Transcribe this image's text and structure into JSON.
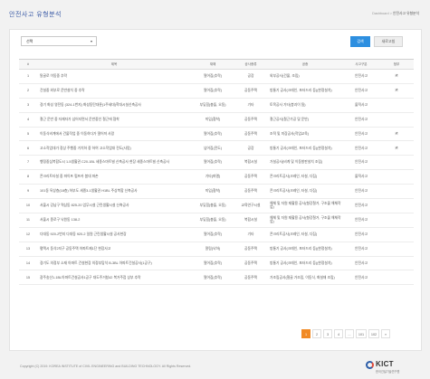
{
  "page": {
    "title": "안전사고 유형분석",
    "breadcrumb": [
      "Dashboard",
      "안전사고 유형분석"
    ],
    "breadcrumb_sep": ">"
  },
  "filter": {
    "select_value": "선택",
    "search_label": "검색",
    "new_label": "새로고침"
  },
  "table": {
    "headers": [
      "#",
      "제목",
      "재해",
      "공사종류",
      "공종",
      "사고구분",
      "첨부"
    ],
    "rows": [
      {
        "num": "1",
        "title": "탈골로 이동중 추락",
        "type": "떨어짐(추락)",
        "work": "공장",
        "process": "외부공사(건물, 조립)",
        "scope": "안전사고",
        "attach": "🖹"
      },
      {
        "num": "2",
        "title": "건설중 외부로 운반설치 중 추락",
        "type": "떨어짐(추락)",
        "work": "공동주택",
        "process": "방통기 공사(크레인, 포터드리 등)(한정설치)",
        "scope": "안전사고",
        "attach": "🖹"
      },
      {
        "num": "3",
        "title": "경기 화성 영전동 (324-1번지) 화성동탄대륜(1주세대)학대시설신축공사",
        "type": "부딪힘(충돌, 오동)",
        "work": "기타",
        "process": "토목공사 기타(붕괴이 됨)",
        "scope": "물적사고",
        "attach": ""
      },
      {
        "num": "4",
        "title": "철근 운반 중 자재자가 넘어지면서 운반중인 철근에 협착",
        "type": "끼임(협착)",
        "work": "공동주택",
        "process": "철근공사(철근가공 및 운반)",
        "scope": "안전사고",
        "attach": ""
      },
      {
        "num": "5",
        "title": "이동식비계에서 건물작업 중 이동하다가 떨어져 사망",
        "type": "떨어짐(추락)",
        "work": "공동주택",
        "process": "조적 및 미장공사(작업교육)",
        "scope": "안전사고",
        "attach": "🖹"
      },
      {
        "num": "6",
        "title": "고소작업대가 정상 주행중 거치하 중 하여 고소작업대 전도(사망)",
        "type": "넘어짐(전도)",
        "work": "공장",
        "process": "방통기 공사(크레인, 포터드리 등)(한정설치)",
        "scope": "안전사고",
        "attach": "🖹"
      },
      {
        "num": "7",
        "title": "행정중심복합도시 1-5생활권 C20-1BL 세종스마트빌 신축공사 현장 세종스마트빌 신축공사",
        "type": "떨어짐(추락)",
        "work": "복합시설",
        "process": "가설공사(비계 및 이동발판설치 조립)",
        "scope": "안전사고",
        "attach": ""
      },
      {
        "num": "8",
        "title": "콘크리트타설 중 파이프 펌프카 붐대 파손",
        "type": "기타(파열)",
        "work": "공동주택",
        "process": "콘크리트공사(크레인, 타설, 다짐)",
        "scope": "물적사고",
        "attach": ""
      },
      {
        "num": "9",
        "title": "101동 옥상층(18층) 하부도 세종3-1생활권 H1BL 주상복합 신축공사",
        "type": "끼임(협착)",
        "work": "공동주택",
        "process": "콘크리트공사(크레인, 타설, 다짐)",
        "scope": "안전사고",
        "attach": ""
      },
      {
        "num": "10",
        "title": "서울시 강남구 역삼동 825-20 업무시설 근린생활시설 신축공사",
        "type": "부딪힘(충돌, 오동)",
        "work": "교육연구시설",
        "process": "해체 및 자원 재활용 공사(형강철거, 구조물 해체작업)",
        "scope": "안전사고",
        "attach": ""
      },
      {
        "num": "11",
        "title": "서울시 종로구 낙원동 138-2",
        "type": "부딪힘(충돌, 오동)",
        "work": "복합시설",
        "process": "해체 및 자원 재활용 공사(형강철거, 구조물 해체작업)",
        "scope": "안전사고",
        "attach": ""
      },
      {
        "num": "12",
        "title": "다대동 920-2번지 다대동 920-2 일원 근린생활시설 공사현장",
        "type": "떨어짐(추락)",
        "work": "기타",
        "process": "콘크리트공사(크레인, 타설, 다짐)",
        "scope": "안전사고",
        "attach": ""
      },
      {
        "num": "13",
        "title": "평택시 동삭2지구 공동주택 아파트제1단 현장사고",
        "type": "깔림(낙하)",
        "work": "공동주택",
        "process": "방통기 공사(크레인, 포터드리 등)(한정설치)",
        "scope": "안전사고",
        "attach": ""
      },
      {
        "num": "14",
        "title": "경기도 의정부 소재 아파트 건설현장 의정부탑석 B-3BL 아파트건설공사(1공구)",
        "type": "떨어짐(추락)",
        "work": "공동주택",
        "process": "방통기 공사(크레인, 포터드리 등)(한정설치)",
        "scope": "안전사고",
        "attach": ""
      },
      {
        "num": "15",
        "title": "광주송산1-1BL아파트건설공사1공구 대도주거창42 복거주점 상부 추락",
        "type": "떨어짐(추락)",
        "work": "공동주택",
        "process": "가조립공사(철골 가조립, 이동식, 화설재 조립)",
        "scope": "안전사고",
        "attach": ""
      }
    ]
  },
  "pagination": {
    "pages": [
      "1",
      "2",
      "3",
      "4"
    ],
    "next": "...",
    "extra": [
      "101",
      "102"
    ],
    "last": "»"
  },
  "footer": {
    "copyright": "Copyright (C) 2019. KOREA INSTITUTE of CIVIL ENGINEERING and BUILDING TECHNOLOGY. All Rights Reserved.",
    "logo": "KICT",
    "logo_sub": "한국건설기술연구원"
  }
}
